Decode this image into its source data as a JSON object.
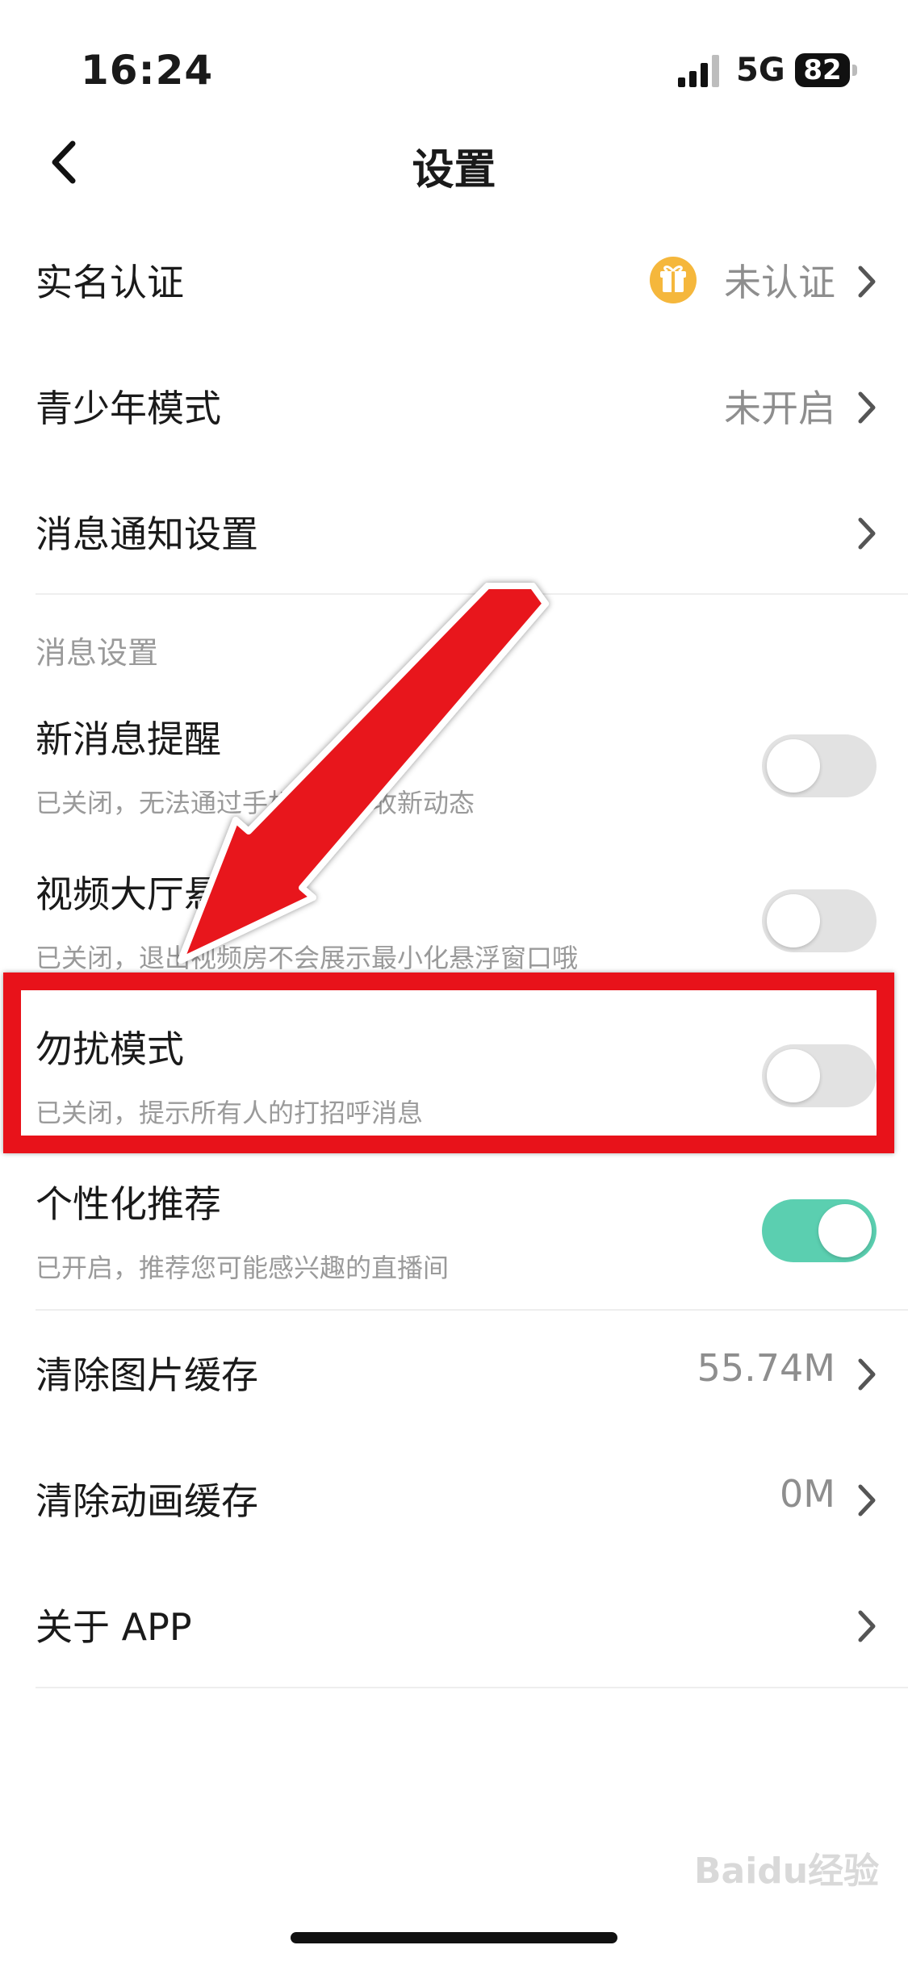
{
  "status_bar": {
    "time": "16:24",
    "network": "5G",
    "battery": "82"
  },
  "nav": {
    "title": "设置",
    "back_icon": "chevron-left-icon"
  },
  "rows": {
    "real_name": {
      "label": "实名认证",
      "value": "未认证",
      "icon": "gift-icon"
    },
    "teen_mode": {
      "label": "青少年模式",
      "value": "未开启"
    },
    "notification_settings": {
      "label": "消息通知设置"
    },
    "image_cache": {
      "label": "清除图片缓存",
      "value": "55.74M"
    },
    "animation_cache": {
      "label": "清除动画缓存",
      "value": "0M"
    },
    "about": {
      "label": "关于 APP"
    }
  },
  "message_section": {
    "title": "消息设置",
    "items": [
      {
        "label": "新消息提醒",
        "desc": "已关闭，无法通过手机通知接收新动态",
        "enabled": false
      },
      {
        "label": "视频大厅悬浮窗",
        "desc": "已关闭，退出视频房不会展示最小化悬浮窗口哦",
        "enabled": false
      },
      {
        "label": "勿扰模式",
        "desc": "已关闭，提示所有人的打招呼消息",
        "enabled": false
      },
      {
        "label": "个性化推荐",
        "desc": "已开启，推荐您可能感兴趣的直播间",
        "enabled": true
      }
    ]
  },
  "colors": {
    "toggle_on": "#5bcfb0",
    "toggle_off": "#e2e2e2",
    "annotation_red": "#e8121a",
    "gift_badge": "#f5b73c"
  },
  "watermark": "Baidu经验"
}
